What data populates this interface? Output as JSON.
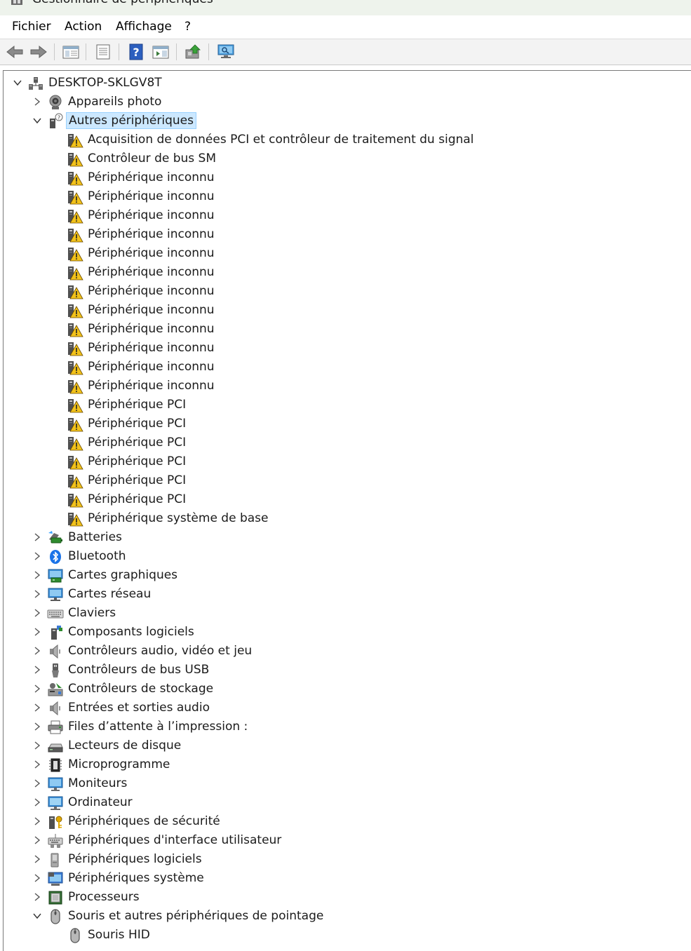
{
  "window": {
    "title": "Gestionnaire de périphériques"
  },
  "menu": [
    "Fichier",
    "Action",
    "Affichage",
    "?"
  ],
  "toolbar": [
    {
      "name": "back-icon"
    },
    {
      "name": "forward-icon"
    },
    {
      "name": "show-hide-console-tree-icon"
    },
    {
      "name": "properties-icon"
    },
    {
      "name": "help-icon"
    },
    {
      "name": "action-pane-icon"
    },
    {
      "name": "update-driver-icon"
    },
    {
      "name": "scan-hardware-changes-icon"
    }
  ],
  "tree": [
    {
      "label": "DESKTOP-SKLGV8T",
      "level": 0,
      "expander": "expanded",
      "icon": "computer-network-icon"
    },
    {
      "label": "Appareils photo",
      "level": 1,
      "expander": "collapsed",
      "icon": "webcam-icon"
    },
    {
      "label": "Autres périphériques",
      "level": 1,
      "expander": "expanded",
      "icon": "unknown-device-icon",
      "selected": true
    },
    {
      "label": "Acquisition de données PCI et contrôleur de traitement du signal",
      "level": 2,
      "expander": "none",
      "icon": "warning-device-icon"
    },
    {
      "label": "Contrôleur de bus SM",
      "level": 2,
      "expander": "none",
      "icon": "warning-device-icon"
    },
    {
      "label": "Périphérique inconnu",
      "level": 2,
      "expander": "none",
      "icon": "warning-device-icon"
    },
    {
      "label": "Périphérique inconnu",
      "level": 2,
      "expander": "none",
      "icon": "warning-device-icon"
    },
    {
      "label": "Périphérique inconnu",
      "level": 2,
      "expander": "none",
      "icon": "warning-device-icon"
    },
    {
      "label": "Périphérique inconnu",
      "level": 2,
      "expander": "none",
      "icon": "warning-device-icon"
    },
    {
      "label": "Périphérique inconnu",
      "level": 2,
      "expander": "none",
      "icon": "warning-device-icon"
    },
    {
      "label": "Périphérique inconnu",
      "level": 2,
      "expander": "none",
      "icon": "warning-device-icon"
    },
    {
      "label": "Périphérique inconnu",
      "level": 2,
      "expander": "none",
      "icon": "warning-device-icon"
    },
    {
      "label": "Périphérique inconnu",
      "level": 2,
      "expander": "none",
      "icon": "warning-device-icon"
    },
    {
      "label": "Périphérique inconnu",
      "level": 2,
      "expander": "none",
      "icon": "warning-device-icon"
    },
    {
      "label": "Périphérique inconnu",
      "level": 2,
      "expander": "none",
      "icon": "warning-device-icon"
    },
    {
      "label": "Périphérique inconnu",
      "level": 2,
      "expander": "none",
      "icon": "warning-device-icon"
    },
    {
      "label": "Périphérique inconnu",
      "level": 2,
      "expander": "none",
      "icon": "warning-device-icon"
    },
    {
      "label": "Périphérique PCI",
      "level": 2,
      "expander": "none",
      "icon": "warning-device-icon"
    },
    {
      "label": "Périphérique PCI",
      "level": 2,
      "expander": "none",
      "icon": "warning-device-icon"
    },
    {
      "label": "Périphérique PCI",
      "level": 2,
      "expander": "none",
      "icon": "warning-device-icon"
    },
    {
      "label": "Périphérique PCI",
      "level": 2,
      "expander": "none",
      "icon": "warning-device-icon"
    },
    {
      "label": "Périphérique PCI",
      "level": 2,
      "expander": "none",
      "icon": "warning-device-icon"
    },
    {
      "label": "Périphérique PCI",
      "level": 2,
      "expander": "none",
      "icon": "warning-device-icon"
    },
    {
      "label": "Périphérique système de base",
      "level": 2,
      "expander": "none",
      "icon": "warning-device-icon"
    },
    {
      "label": "Batteries",
      "level": 1,
      "expander": "collapsed",
      "icon": "battery-icon"
    },
    {
      "label": "Bluetooth",
      "level": 1,
      "expander": "collapsed",
      "icon": "bluetooth-icon"
    },
    {
      "label": "Cartes graphiques",
      "level": 1,
      "expander": "collapsed",
      "icon": "display-adapter-icon"
    },
    {
      "label": "Cartes réseau",
      "level": 1,
      "expander": "collapsed",
      "icon": "network-adapter-icon"
    },
    {
      "label": "Claviers",
      "level": 1,
      "expander": "collapsed",
      "icon": "keyboard-icon"
    },
    {
      "label": "Composants logiciels",
      "level": 1,
      "expander": "collapsed",
      "icon": "software-component-icon"
    },
    {
      "label": "Contrôleurs audio, vidéo et jeu",
      "level": 1,
      "expander": "collapsed",
      "icon": "speaker-icon"
    },
    {
      "label": "Contrôleurs de bus USB",
      "level": 1,
      "expander": "collapsed",
      "icon": "usb-icon"
    },
    {
      "label": "Contrôleurs de stockage",
      "level": 1,
      "expander": "collapsed",
      "icon": "storage-controller-icon"
    },
    {
      "label": "Entrées et sorties audio",
      "level": 1,
      "expander": "collapsed",
      "icon": "speaker-icon"
    },
    {
      "label": "Files d’attente à l’impression :",
      "level": 1,
      "expander": "collapsed",
      "icon": "printer-icon"
    },
    {
      "label": "Lecteurs de disque",
      "level": 1,
      "expander": "collapsed",
      "icon": "disk-drive-icon"
    },
    {
      "label": "Microprogramme",
      "level": 1,
      "expander": "collapsed",
      "icon": "firmware-chip-icon"
    },
    {
      "label": "Moniteurs",
      "level": 1,
      "expander": "collapsed",
      "icon": "monitor-icon"
    },
    {
      "label": "Ordinateur",
      "level": 1,
      "expander": "collapsed",
      "icon": "computer-icon"
    },
    {
      "label": "Périphériques de sécurité",
      "level": 1,
      "expander": "collapsed",
      "icon": "security-key-icon"
    },
    {
      "label": "Périphériques d'interface utilisateur",
      "level": 1,
      "expander": "collapsed",
      "icon": "hid-icon"
    },
    {
      "label": "Périphériques logiciels",
      "level": 1,
      "expander": "collapsed",
      "icon": "software-device-icon"
    },
    {
      "label": "Périphériques système",
      "level": 1,
      "expander": "collapsed",
      "icon": "system-device-icon"
    },
    {
      "label": "Processeurs",
      "level": 1,
      "expander": "collapsed",
      "icon": "processor-icon"
    },
    {
      "label": "Souris et autres périphériques de pointage",
      "level": 1,
      "expander": "expanded",
      "icon": "mouse-icon"
    },
    {
      "label": "Souris HID",
      "level": 2,
      "expander": "none",
      "icon": "mouse-icon"
    }
  ]
}
